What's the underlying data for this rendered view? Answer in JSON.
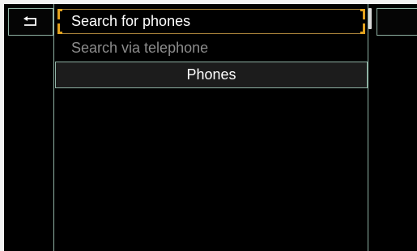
{
  "back_button": {
    "icon": "back-arrow-icon"
  },
  "list": {
    "items": [
      {
        "label": "Search for phones",
        "state": "focused"
      },
      {
        "label": "Search via telephone",
        "state": "disabled"
      }
    ],
    "section_header": "Phones"
  },
  "colors": {
    "background": "#000000",
    "border": "#8fb2a4",
    "focus": "#e2a21e",
    "text": "#ffffff",
    "disabled_text": "#8c8c8c"
  }
}
